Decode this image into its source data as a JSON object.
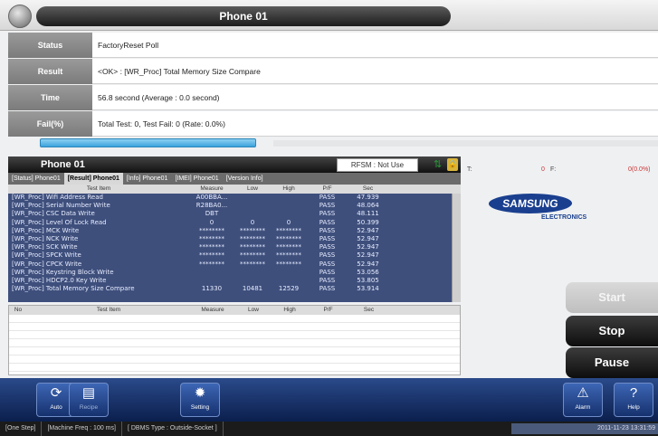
{
  "window": {
    "title": "Phone 01"
  },
  "info": {
    "status_label": "Status",
    "status_value": "FactoryReset Poll",
    "result_label": "Result",
    "result_value": "<OK> : [WR_Proc] Total Memory Size Compare",
    "time_label": "Time",
    "time_value": "56.8 second (Average : 0.0 second)",
    "fail_label": "Fail(%)",
    "fail_value": "Total Test: 0, Test Fail: 0 (Rate: 0.0%)"
  },
  "progress": {
    "fraction": 0.35
  },
  "phone_panel": {
    "title": "Phone 01",
    "rfsm": "RFSM : Not Use",
    "tabs": [
      "[Status] Phone01",
      "[Result] Phone01",
      "[Info] Phone01",
      "[IMEI] Phone01",
      "[Version Info]"
    ],
    "active_tab": 1,
    "tf_t": "T:",
    "tf_count": "0",
    "tf_f": "F:",
    "tf_rate": "0(0.0%)"
  },
  "results": {
    "headers": [
      "Test Item",
      "Measure",
      "Low",
      "High",
      "P/F",
      "Sec"
    ],
    "rows": [
      [
        "[WR_Proc] Wifi Address Read",
        "A00BBA...",
        "",
        "",
        "PASS",
        "47.939"
      ],
      [
        "[WR_Proc] Serial Number Write",
        "R28BA0...",
        "",
        "",
        "PASS",
        "48.064"
      ],
      [
        "[WR_Proc] CSC Data Write",
        "DBT",
        "",
        "",
        "PASS",
        "48.111"
      ],
      [
        "[WR_Proc] Level Of Lock Read",
        "0",
        "0",
        "0",
        "PASS",
        "50.399"
      ],
      [
        "[WR_Proc] MCK Write",
        "********",
        "********",
        "********",
        "PASS",
        "52.947"
      ],
      [
        "[WR_Proc] NCK Write",
        "********",
        "********",
        "********",
        "PASS",
        "52.947"
      ],
      [
        "[WR_Proc] SCK Write",
        "********",
        "********",
        "********",
        "PASS",
        "52.947"
      ],
      [
        "[WR_Proc] SPCK Write",
        "********",
        "********",
        "********",
        "PASS",
        "52.947"
      ],
      [
        "[WR_Proc] CPCK Write",
        "********",
        "********",
        "********",
        "PASS",
        "52.947"
      ],
      [
        "[WR_Proc] Keystring Block Write",
        "",
        "",
        "",
        "PASS",
        "53.056"
      ],
      [
        "[WR_Proc] HDCP2.0 Key Write",
        "",
        "",
        "",
        "PASS",
        "53.805"
      ],
      [
        "[WR_Proc] Total Memory Size Compare",
        "11330",
        "10481",
        "12529",
        "PASS",
        "53.914"
      ]
    ]
  },
  "results2": {
    "headers": [
      "No",
      "Test Item",
      "Measure",
      "Low",
      "High",
      "P/F",
      "Sec"
    ]
  },
  "brand": {
    "name": "SAMSUNG",
    "sub": "ELECTRONICS"
  },
  "controls": {
    "start": "Start",
    "stop": "Stop",
    "pause": "Pause"
  },
  "toolbar": {
    "auto": "Auto",
    "recipe": "Recipe",
    "setting": "Setting",
    "alarm": "Alarm",
    "help": "Help"
  },
  "statusbar": {
    "items": [
      "[One Step]",
      "[Machine Freq : 100 ms]",
      "[ DBMS Type : Outside-Socket ]"
    ],
    "datetime": "2011-11-23 13:31:59"
  },
  "colors": {
    "accent": "#3ba3dd",
    "panel": "#3e4f7c",
    "toolbar": "#1a3a7a"
  }
}
